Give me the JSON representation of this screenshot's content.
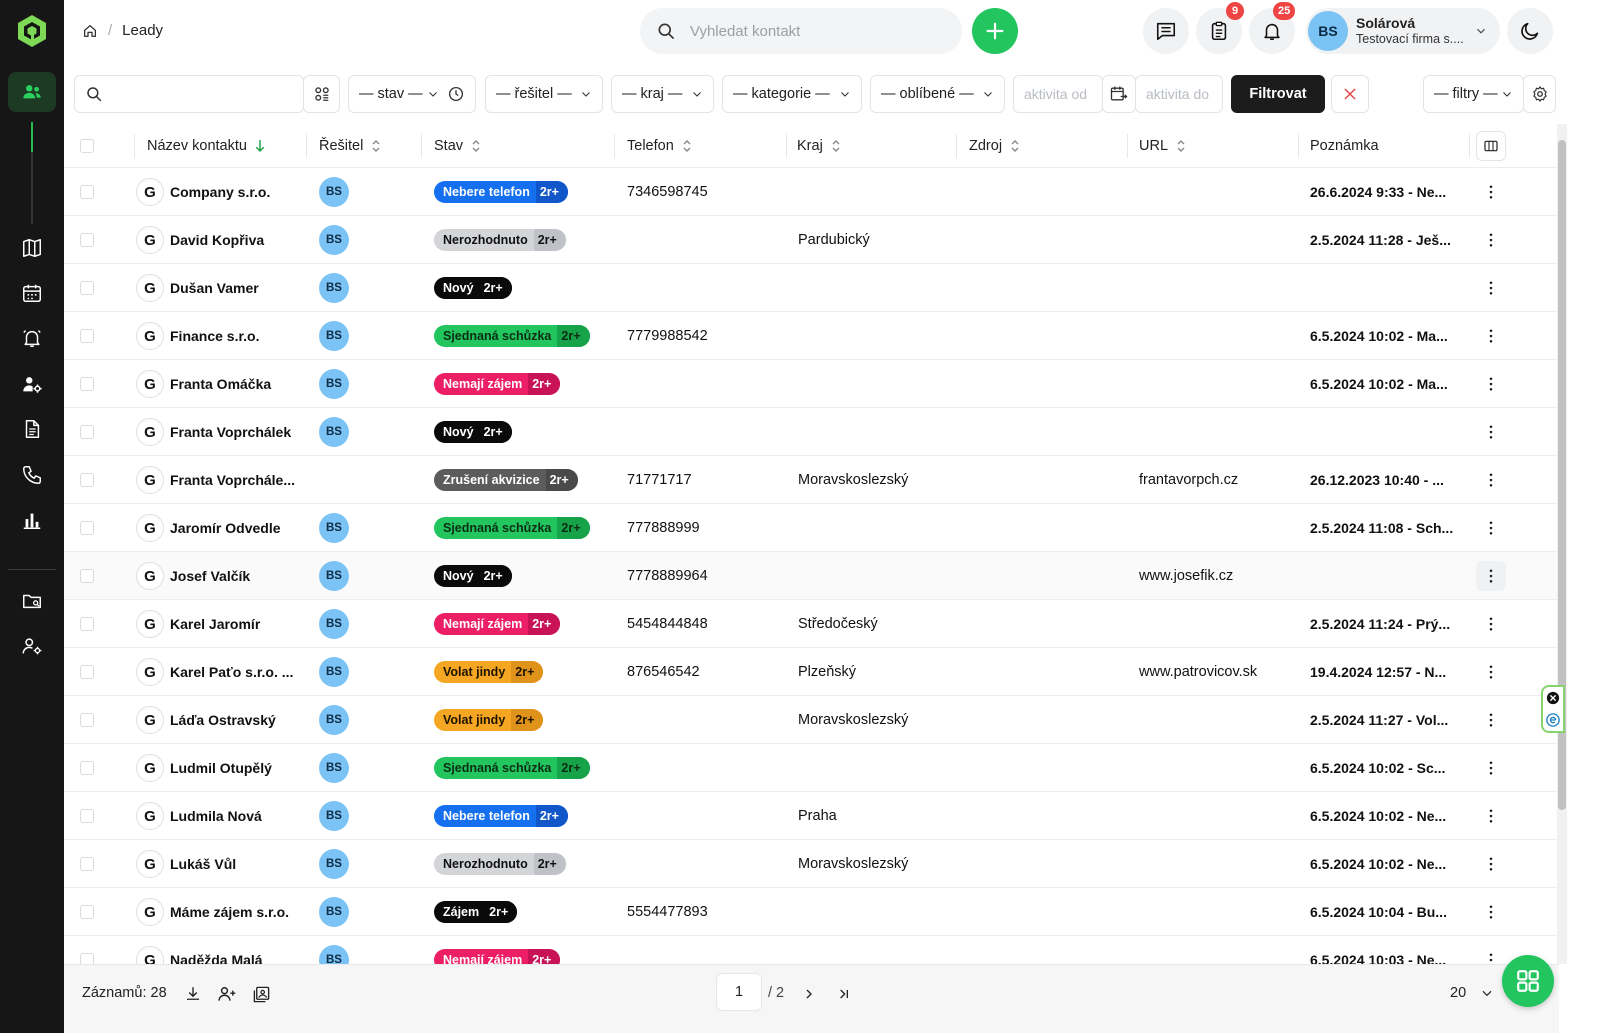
{
  "colors": {
    "accent": "#22c55e",
    "sidebar_bg": "#161616",
    "badge": "#ef4444",
    "avatar": "#7cc3f5"
  },
  "header": {
    "breadcrumb": "Leady",
    "search_placeholder": "Vyhledat kontakt",
    "tasks_badge": "9",
    "notifications_badge": "25",
    "user": {
      "initials": "BS",
      "name": "Solárová",
      "company": "Testovací firma s...."
    }
  },
  "filters": {
    "search_value": "",
    "stav": "— stav —",
    "resitel": "— řešitel —",
    "kraj": "— kraj —",
    "kategorie": "— kategorie —",
    "oblibene": "— oblíbené —",
    "aktivita_od": "aktivita od",
    "aktivita_do": "aktivita do",
    "filter_button": "Filtrovat",
    "saved_filters": "— filtry —"
  },
  "table": {
    "columns": [
      "Název kontaktu",
      "Řešitel",
      "Stav",
      "Telefon",
      "Kraj",
      "Zdroj",
      "URL",
      "Poznámka"
    ],
    "rows": [
      {
        "name": "Company s.r.o.",
        "assignee": "BS",
        "status": "Nebere telefon",
        "count": "2r+",
        "phone": "7346598745",
        "region": "",
        "source": "",
        "url": "",
        "note": "26.6.2024 9:33 - Ne...",
        "sc": "#1570ef",
        "sc2": "#1257c9",
        "st": "#ffffff"
      },
      {
        "name": "David Kopřiva",
        "assignee": "BS",
        "status": "Nerozhodnuto",
        "count": "2r+",
        "phone": "",
        "region": "Pardubický",
        "source": "",
        "url": "",
        "note": "2.5.2024 11:28 - Ješ...",
        "sc": "#d3d5d9",
        "sc2": "#bfc2c7",
        "st": "#111111"
      },
      {
        "name": "Dušan Vamer",
        "assignee": "BS",
        "status": "Nový",
        "count": "2r+",
        "phone": "",
        "region": "",
        "source": "",
        "url": "",
        "note": "",
        "sc": "#0a0a0a",
        "sc2": "#0a0a0a",
        "st": "#ffffff"
      },
      {
        "name": "Finance s.r.o.",
        "assignee": "BS",
        "status": "Sjednaná schůzka",
        "count": "2r+",
        "phone": "7779988542",
        "region": "",
        "source": "",
        "url": "",
        "note": "6.5.2024 10:02 - Ma...",
        "sc": "#22c55e",
        "sc2": "#16a34a",
        "st": "#0b2e14"
      },
      {
        "name": "Franta Omáčka",
        "assignee": "BS",
        "status": "Nemají zájem",
        "count": "2r+",
        "phone": "",
        "region": "",
        "source": "",
        "url": "",
        "note": "6.5.2024 10:02 - Ma...",
        "sc": "#ec1f66",
        "sc2": "#c81456",
        "st": "#ffffff"
      },
      {
        "name": "Franta Voprchálek",
        "assignee": "BS",
        "status": "Nový",
        "count": "2r+",
        "phone": "",
        "region": "",
        "source": "",
        "url": "",
        "note": "",
        "sc": "#0a0a0a",
        "sc2": "#0a0a0a",
        "st": "#ffffff"
      },
      {
        "name": "Franta Voprchále...",
        "assignee": "",
        "status": "Zrušení akvizice",
        "count": "2r+",
        "phone": "71771717",
        "region": "Moravskoslezský",
        "source": "",
        "url": "frantavorpch.cz",
        "note": "26.12.2023 10:40 - ...",
        "sc": "#5c5c5c",
        "sc2": "#4a4a4a",
        "st": "#ffffff"
      },
      {
        "name": "Jaromír Odvedle",
        "assignee": "BS",
        "status": "Sjednaná schůzka",
        "count": "2r+",
        "phone": "777888999",
        "region": "",
        "source": "",
        "url": "",
        "note": "2.5.2024 11:08 - Sch...",
        "sc": "#22c55e",
        "sc2": "#16a34a",
        "st": "#0b2e14"
      },
      {
        "name": "Josef Valčík",
        "assignee": "BS",
        "status": "Nový",
        "count": "2r+",
        "phone": "7778889964",
        "region": "",
        "source": "",
        "url": "www.josefik.cz",
        "note": "",
        "sc": "#0a0a0a",
        "sc2": "#0a0a0a",
        "st": "#ffffff"
      },
      {
        "name": "Karel Jaromír",
        "assignee": "BS",
        "status": "Nemají zájem",
        "count": "2r+",
        "phone": "5454844848",
        "region": "Středočeský",
        "source": "",
        "url": "",
        "note": "2.5.2024 11:24 - Prý...",
        "sc": "#ec1f66",
        "sc2": "#c81456",
        "st": "#ffffff"
      },
      {
        "name": "Karel Paťo s.r.o. ...",
        "assignee": "BS",
        "status": "Volat jindy",
        "count": "2r+",
        "phone": "876546542",
        "region": "Plzeňský",
        "source": "",
        "url": "www.patrovicov.sk",
        "note": "19.4.2024 12:57 - N...",
        "sc": "#f5a623",
        "sc2": "#e0931a",
        "st": "#1f1400"
      },
      {
        "name": "Láďa Ostravský",
        "assignee": "BS",
        "status": "Volat jindy",
        "count": "2r+",
        "phone": "",
        "region": "Moravskoslezský",
        "source": "",
        "url": "",
        "note": "2.5.2024 11:27 - Vol...",
        "sc": "#f5a623",
        "sc2": "#e0931a",
        "st": "#1f1400"
      },
      {
        "name": "Ludmil Otupělý",
        "assignee": "BS",
        "status": "Sjednaná schůzka",
        "count": "2r+",
        "phone": "",
        "region": "",
        "source": "",
        "url": "",
        "note": "6.5.2024 10:02 - Sc...",
        "sc": "#22c55e",
        "sc2": "#16a34a",
        "st": "#0b2e14"
      },
      {
        "name": "Ludmila Nová",
        "assignee": "BS",
        "status": "Nebere telefon",
        "count": "2r+",
        "phone": "",
        "region": "Praha",
        "source": "",
        "url": "",
        "note": "6.5.2024 10:02 - Ne...",
        "sc": "#1570ef",
        "sc2": "#1257c9",
        "st": "#ffffff"
      },
      {
        "name": "Lukáš Vůl",
        "assignee": "BS",
        "status": "Nerozhodnuto",
        "count": "2r+",
        "phone": "",
        "region": "Moravskoslezský",
        "source": "",
        "url": "",
        "note": "6.5.2024 10:02 - Ne...",
        "sc": "#d3d5d9",
        "sc2": "#bfc2c7",
        "st": "#111111"
      },
      {
        "name": "Máme zájem s.r.o.",
        "assignee": "BS",
        "status": "Zájem",
        "count": "2r+",
        "phone": "5554477893",
        "region": "",
        "source": "",
        "url": "",
        "note": "6.5.2024 10:04 - Bu...",
        "sc": "#0a0a0a",
        "sc2": "#0a0a0a",
        "st": "#ffffff"
      },
      {
        "name": "Naděžda Malá",
        "assignee": "BS",
        "status": "Nemají zájem",
        "count": "2r+",
        "phone": "",
        "region": "",
        "source": "",
        "url": "",
        "note": "6.5.2024 10:03 - Ne...",
        "sc": "#ec1f66",
        "sc2": "#c81456",
        "st": "#ffffff"
      }
    ]
  },
  "footer": {
    "records_label": "Záznamů: 28",
    "current_page": "1",
    "total_pages": "/ 2",
    "page_size": "20"
  }
}
